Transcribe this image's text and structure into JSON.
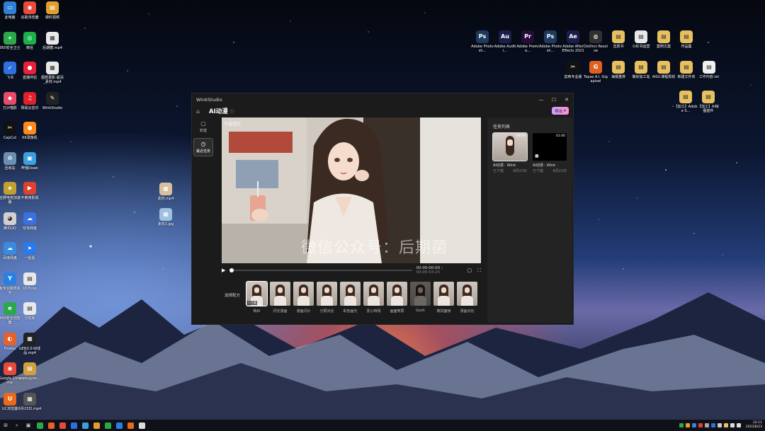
{
  "desktop": {
    "left_icons": [
      {
        "label": "此电脑",
        "color": "#2f7fd6",
        "glyph": "▭"
      },
      {
        "label": "谷歌浏览器",
        "color": "#e54b3c",
        "glyph": "◉"
      },
      {
        "label": "做时视频",
        "color": "#e0a030",
        "glyph": "▤"
      },
      {
        "label": "360安全卫士",
        "color": "#2aa84a",
        "glyph": "+"
      },
      {
        "label": "微信",
        "color": "#1ab04a",
        "glyph": "◎"
      },
      {
        "label": "后期菌.mp4",
        "color": "#e8e8e8",
        "glyph": "▦"
      },
      {
        "label": "飞书",
        "color": "#2f6fe0",
        "glyph": "➶"
      },
      {
        "label": "直播伴侣",
        "color": "#e8203a",
        "glyph": "●"
      },
      {
        "label": "图想录影-超清_素材.mp4",
        "color": "#e8e8e8",
        "glyph": "▦"
      },
      {
        "label": "万兴喵影",
        "color": "#e84a6a",
        "glyph": "◆"
      },
      {
        "label": "网易云音乐",
        "color": "#e0202a",
        "glyph": "♫"
      },
      {
        "label": "WinkStudio",
        "color": "#222222",
        "glyph": "✎"
      },
      {
        "label": "CapCut",
        "color": "#111111",
        "glyph": "✂"
      },
      {
        "label": "KK录像机",
        "color": "#ff8a1a",
        "glyph": "●"
      },
      {
        "label": "回收站",
        "color": "#6a8fb0",
        "glyph": "♻"
      },
      {
        "label": "哔哩Down",
        "color": "#3aa0e0",
        "glyph": "▣"
      },
      {
        "label": "狂野电竞加速器",
        "color": "#c0a030",
        "glyph": "◈"
      },
      {
        "label": "不黄用影视",
        "color": "#e04030",
        "glyph": "▶"
      },
      {
        "label": "腾讯QQ",
        "color": "#d0d0d0",
        "glyph": "◕"
      },
      {
        "label": "夸克网盘",
        "color": "#3a70e0",
        "glyph": "☁"
      },
      {
        "label": "百度网盘",
        "color": "#3a8ae0",
        "glyph": "☁"
      },
      {
        "label": "一起看",
        "color": "#2a7ae8",
        "glyph": "➤"
      },
      {
        "label": "有专业服务执手",
        "color": "#2a80e0",
        "glyph": "Y"
      },
      {
        "label": "UCEcoo",
        "color": "#e8e8e8",
        "glyph": "▤"
      },
      {
        "label": "360安全浏览器",
        "color": "#2aa84a",
        "glyph": "e"
      },
      {
        "label": "分享库",
        "color": "#e8e8e8",
        "glyph": "▤"
      },
      {
        "label": "Firefox",
        "color": "#e8602a",
        "glyph": "◐"
      },
      {
        "label": "GEN2.0-W成品.mp4",
        "color": "#222222",
        "glyph": "▦"
      },
      {
        "label": "Google Chrome",
        "color": "#e54b3c",
        "glyph": "◉"
      },
      {
        "label": "www.gyan...",
        "color": "#d0a040",
        "glyph": "▤"
      },
      {
        "label": "UC浏览器",
        "color": "#e86a1a",
        "glyph": "U"
      },
      {
        "label": "8月23日.mp4",
        "color": "#555555",
        "glyph": "▦"
      }
    ],
    "mid_icons": [
      {
        "label": "素材.mp4",
        "color": "#d8c0a0",
        "glyph": "▦"
      },
      {
        "label": "素材2.jpg",
        "color": "#a0c0e0",
        "glyph": "▦"
      }
    ],
    "right_icons_row1": [
      {
        "label": "Adobe Photosh...",
        "color": "#1f3a5f",
        "glyph": "Ps"
      },
      {
        "label": "Adobe Auditi...",
        "color": "#1d1d4a",
        "glyph": "Au"
      },
      {
        "label": "Adobe Premie...",
        "color": "#2a0a3a",
        "glyph": "Pr"
      },
      {
        "label": "Adobe Photosh...",
        "color": "#1f3a5f",
        "glyph": "Ps"
      },
      {
        "label": "Adobe After Effects 2021",
        "color": "#1d1d4a",
        "glyph": "Ae"
      },
      {
        "label": "DaVinci Resolve",
        "color": "#303030",
        "glyph": "◍"
      },
      {
        "label": "志愿书",
        "color": "#e8c060",
        "glyph": "▤"
      },
      {
        "label": "小红书运营",
        "color": "#e8e8e8",
        "glyph": "▤"
      },
      {
        "label": "案例文案",
        "color": "#e8c060",
        "glyph": "▤"
      },
      {
        "label": "作品集",
        "color": "#e8c060",
        "glyph": "▤"
      }
    ],
    "right_icons_row2": [
      {
        "label": "剪映专业版",
        "color": "#111111",
        "glyph": "✂"
      },
      {
        "label": "Topaz A.I. Gigapixel",
        "color": "#e06020",
        "glyph": "G"
      },
      {
        "label": "海报重排",
        "color": "#e8c060",
        "glyph": "▤"
      },
      {
        "label": "做好加工站",
        "color": "#e8c060",
        "glyph": "▤"
      },
      {
        "label": "AIGC课程规划",
        "color": "#e8c060",
        "glyph": "▤"
      },
      {
        "label": "新建文件夹",
        "color": "#e8c060",
        "glyph": "▤"
      },
      {
        "label": "工作内容.txt",
        "color": "#f0f0f0",
        "glyph": "▤"
      }
    ],
    "right_icons_row3": [
      {
        "label": "【加工】Adobe S...",
        "color": "#e8c060",
        "glyph": "▤"
      },
      {
        "label": "【加工】AI绘图插件",
        "color": "#e8c060",
        "glyph": "▤"
      }
    ]
  },
  "window": {
    "app_name": "WinkStudio",
    "page_title": "AI动漫",
    "export_label": "导出",
    "sidebar": [
      {
        "label": "新建",
        "icon": "document-icon",
        "glyph": "▢"
      },
      {
        "label": "最近任务",
        "icon": "history-icon",
        "glyph": "◷"
      }
    ],
    "preview": {
      "watermark": "微信公众号：后期菌",
      "logo_text": "R自由C"
    },
    "player": {
      "current_time": "00:00:00:00",
      "duration": "/ 00:00:03:15"
    },
    "presets_label": "选择配方",
    "presets": [
      {
        "name": "纯AI",
        "selected": true,
        "tag": "已下载",
        "dim": false
      },
      {
        "name": "闪光漫画",
        "selected": false,
        "tag": "",
        "dim": false
      },
      {
        "name": "漫画闪片",
        "selected": false,
        "tag": "",
        "dim": false
      },
      {
        "name": "分屏对比",
        "selected": false,
        "tag": "",
        "dim": false
      },
      {
        "name": "彩色画光",
        "selected": false,
        "tag": "",
        "dim": false
      },
      {
        "name": "爱心特场",
        "selected": false,
        "tag": "",
        "dim": false
      },
      {
        "name": "画面穿屏",
        "selected": false,
        "tag": "",
        "dim": false
      },
      {
        "name": "Gosh",
        "selected": false,
        "tag": "",
        "dim": true
      },
      {
        "name": "擦拭面帧",
        "selected": false,
        "tag": "",
        "dim": false
      },
      {
        "name": "漫画对比",
        "selected": false,
        "tag": "",
        "dim": false
      }
    ],
    "tasks_title": "任务列表",
    "tasks": [
      {
        "name": "AI动漫 - Wink",
        "status": "已下载",
        "date": "8月23日",
        "duration": "00:04",
        "selected": true
      },
      {
        "name": "AI动漫 - Wink",
        "status": "已下载",
        "date": "8月23日",
        "duration": "01:00",
        "selected": false
      }
    ]
  },
  "taskbar": {
    "time": "22:11",
    "date": "2023/8/23"
  }
}
